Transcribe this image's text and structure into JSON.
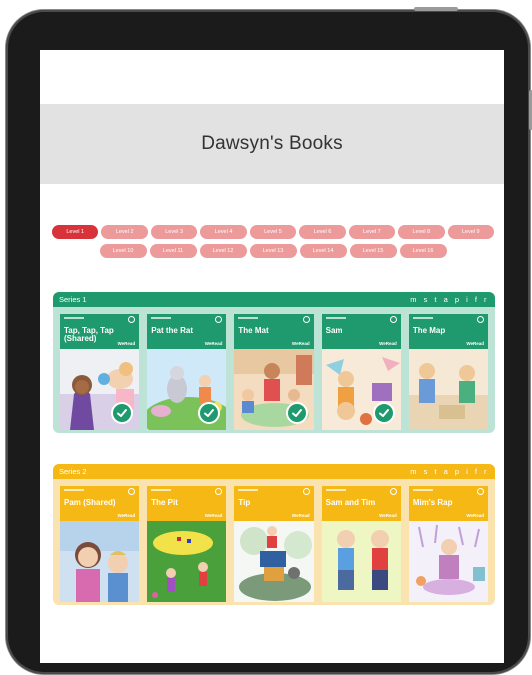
{
  "page": {
    "title": "Dawsyn's Books"
  },
  "levels": {
    "row1": [
      "Level 1",
      "Level 2",
      "Level 3",
      "Level 4",
      "Level 5",
      "Level 6",
      "Level 7",
      "Level 8",
      "Level 9"
    ],
    "row2": [
      "Level 10",
      "Level 11",
      "Level 12",
      "Level 13",
      "Level 14",
      "Level 15",
      "Level 16"
    ],
    "active": "Level 1"
  },
  "series": [
    {
      "name": "Series 1",
      "phonemes": "m s t a p i f r",
      "books": [
        {
          "title": "Tap, Tap, Tap (Shared)",
          "brand": "WeRead",
          "completed": true
        },
        {
          "title": "Pat the Rat",
          "brand": "WeRead",
          "completed": true
        },
        {
          "title": "The Mat",
          "brand": "WeRead",
          "completed": true
        },
        {
          "title": "Sam",
          "brand": "WeRead",
          "completed": true
        },
        {
          "title": "The Map",
          "brand": "WeRead",
          "completed": false
        }
      ]
    },
    {
      "name": "Series 2",
      "phonemes": "m s t a p i f r",
      "books": [
        {
          "title": "Pam (Shared)",
          "brand": "WeRead",
          "completed": false
        },
        {
          "title": "The Pit",
          "brand": "WeRead",
          "completed": false
        },
        {
          "title": "Tip",
          "brand": "WeRead",
          "completed": false
        },
        {
          "title": "Sam and Tim",
          "brand": "WeRead",
          "completed": false
        },
        {
          "title": "Mim's Rap",
          "brand": "WeRead",
          "completed": false
        }
      ]
    }
  ],
  "colors": {
    "series1": "#1f9a6e",
    "series2": "#f6b815",
    "level_active": "#d8333a",
    "level_inactive": "#ec9a9a"
  },
  "icons": {
    "completed": "check-icon"
  }
}
